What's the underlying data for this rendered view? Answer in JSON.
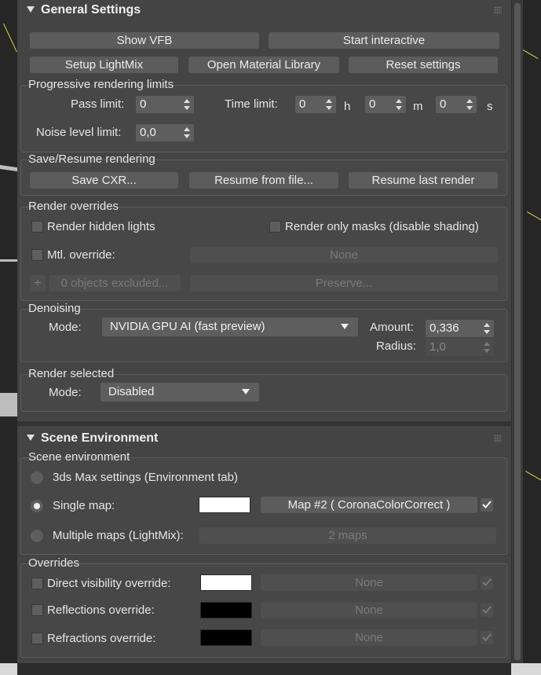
{
  "general": {
    "title": "General Settings",
    "show_vfb": "Show VFB",
    "start_interactive": "Start interactive",
    "setup_lightmix": "Setup LightMix",
    "open_material_library": "Open Material Library",
    "reset_settings": "Reset settings"
  },
  "progressive": {
    "title": "Progressive rendering limits",
    "pass_limit_label": "Pass limit:",
    "pass_limit": "0",
    "time_limit_label": "Time limit:",
    "hours": "0",
    "hours_unit": "h",
    "minutes": "0",
    "minutes_unit": "m",
    "seconds": "0",
    "seconds_unit": "s",
    "noise_label": "Noise level limit:",
    "noise": "0,0"
  },
  "save_resume": {
    "title": "Save/Resume rendering",
    "save_cxr": "Save CXR...",
    "resume_file": "Resume from file...",
    "resume_last": "Resume last render"
  },
  "overrides_render": {
    "title": "Render overrides",
    "hidden_lights": "Render hidden lights",
    "only_masks": "Render only masks (disable shading)",
    "mtl_override": "Mtl. override:",
    "mtl_value": "None",
    "plus": "+",
    "excluded": "0 objects excluded...",
    "preserve": "Preserve..."
  },
  "denoising": {
    "title": "Denoising",
    "mode_label": "Mode:",
    "mode": "NVIDIA GPU AI (fast preview)",
    "amount_label": "Amount:",
    "amount": "0,336",
    "radius_label": "Radius:",
    "radius": "1,0"
  },
  "render_selected": {
    "title": "Render selected",
    "mode_label": "Mode:",
    "mode": "Disabled"
  },
  "scene": {
    "title": "Scene Environment",
    "group_title": "Scene environment",
    "max_settings": "3ds Max settings (Environment tab)",
    "single_map": "Single map:",
    "single_map_color": "#ffffff",
    "map_button": "Map #2  ( CoronaColorCorrect )",
    "multiple_maps": "Multiple maps (LightMix):",
    "multiple_value": "2 maps"
  },
  "env_overrides": {
    "title": "Overrides",
    "direct": "Direct visibility override:",
    "direct_color": "#ffffff",
    "direct_value": "None",
    "reflections": "Reflections override:",
    "reflections_color": "#000000",
    "reflections_value": "None",
    "refractions": "Refractions override:",
    "refractions_color": "#000000",
    "refractions_value": "None"
  }
}
